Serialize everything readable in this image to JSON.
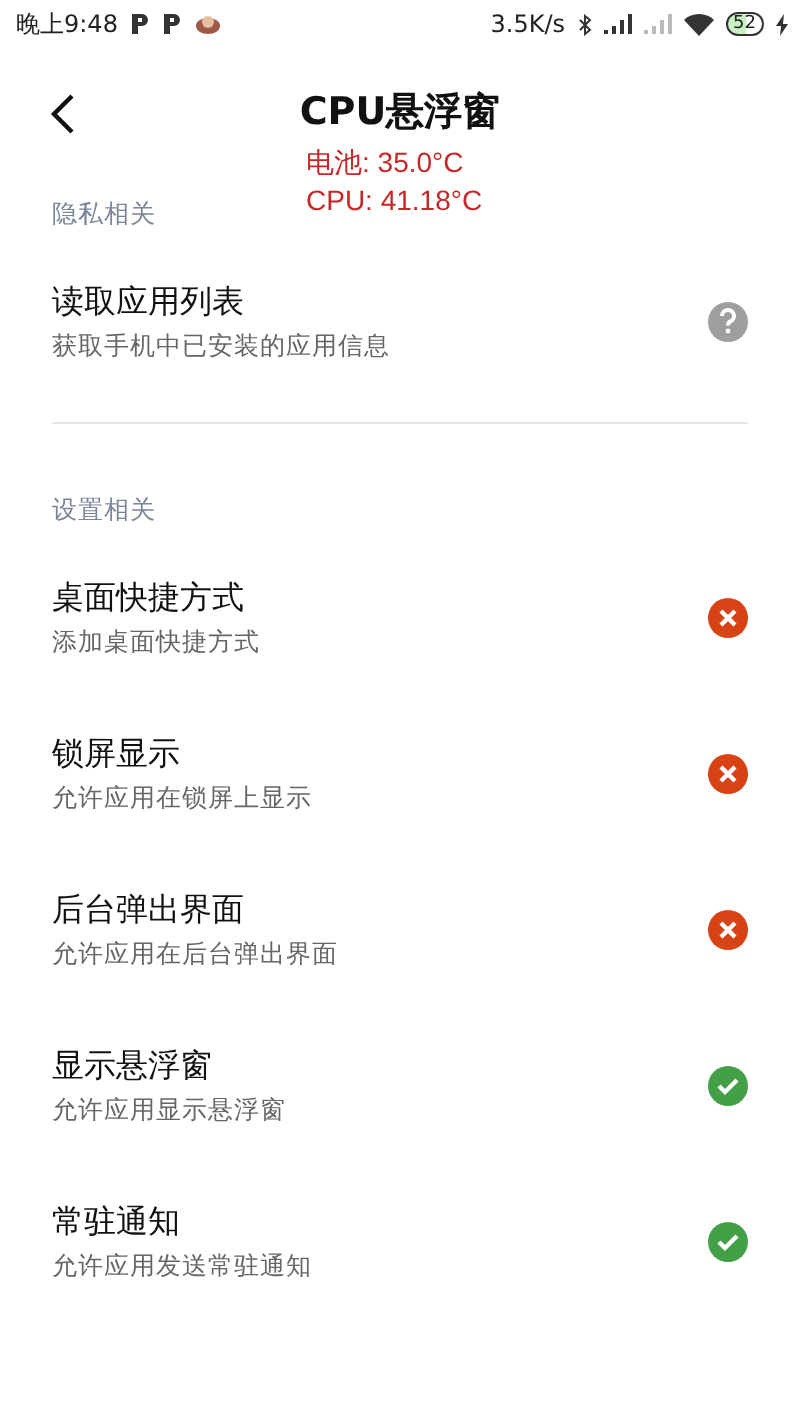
{
  "status_bar": {
    "time": "晚上9:48",
    "net_speed": "3.5K/s",
    "battery": "52"
  },
  "header": {
    "title": "CPU悬浮窗"
  },
  "overlay": {
    "lines": [
      "电池: 35.0°C",
      "CPU: 41.18°C"
    ]
  },
  "sections": [
    {
      "title": "隐私相关",
      "items": [
        {
          "title": "读取应用列表",
          "subtitle": "获取手机中已安装的应用信息",
          "kind": "unknown"
        }
      ]
    },
    {
      "title": "设置相关",
      "items": [
        {
          "title": "桌面快捷方式",
          "subtitle": "添加桌面快捷方式",
          "kind": "denied"
        },
        {
          "title": "锁屏显示",
          "subtitle": "允许应用在锁屏上显示",
          "kind": "denied"
        },
        {
          "title": "后台弹出界面",
          "subtitle": "允许应用在后台弹出界面",
          "kind": "denied"
        },
        {
          "title": "显示悬浮窗",
          "subtitle": "允许应用显示悬浮窗",
          "kind": "granted"
        },
        {
          "title": "常驻通知",
          "subtitle": "允许应用发送常驻通知",
          "kind": "granted"
        }
      ]
    }
  ]
}
